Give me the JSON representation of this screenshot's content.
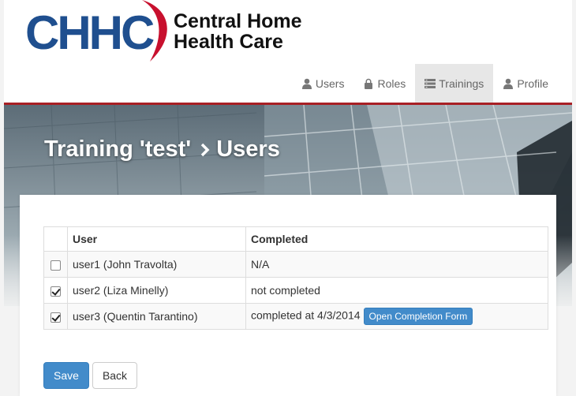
{
  "brand": {
    "logo_mark": "CHHC",
    "name_line1": "Central Home",
    "name_line2": "Health Care",
    "logo_blue": "#1f4f8f",
    "logo_red": "#c8102e"
  },
  "nav": {
    "items": [
      {
        "label": "Users",
        "icon": "user-icon",
        "active": false
      },
      {
        "label": "Roles",
        "icon": "lock-icon",
        "active": false
      },
      {
        "label": "Trainings",
        "icon": "list-icon",
        "active": true
      },
      {
        "label": "Profile",
        "icon": "user-icon",
        "active": false
      }
    ]
  },
  "page": {
    "title_part1": "Training 'test'",
    "title_separator_icon": "chevron-right-icon",
    "title_part2": "Users"
  },
  "table": {
    "headers": [
      "",
      "User",
      "Completed"
    ],
    "rows": [
      {
        "checked": false,
        "user": "user1 (John Travolta)",
        "completed": "N/A"
      },
      {
        "checked": true,
        "user": "user2 (Liza Minelly)",
        "completed": "not completed"
      },
      {
        "checked": true,
        "user": "user3 (Quentin Tarantino)",
        "completed": "completed at 4/3/2014",
        "action": "Open Completion Form"
      }
    ]
  },
  "buttons": {
    "save": "Save",
    "back": "Back"
  },
  "colors": {
    "accent_red": "#a81f24",
    "primary_blue": "#428bca"
  }
}
